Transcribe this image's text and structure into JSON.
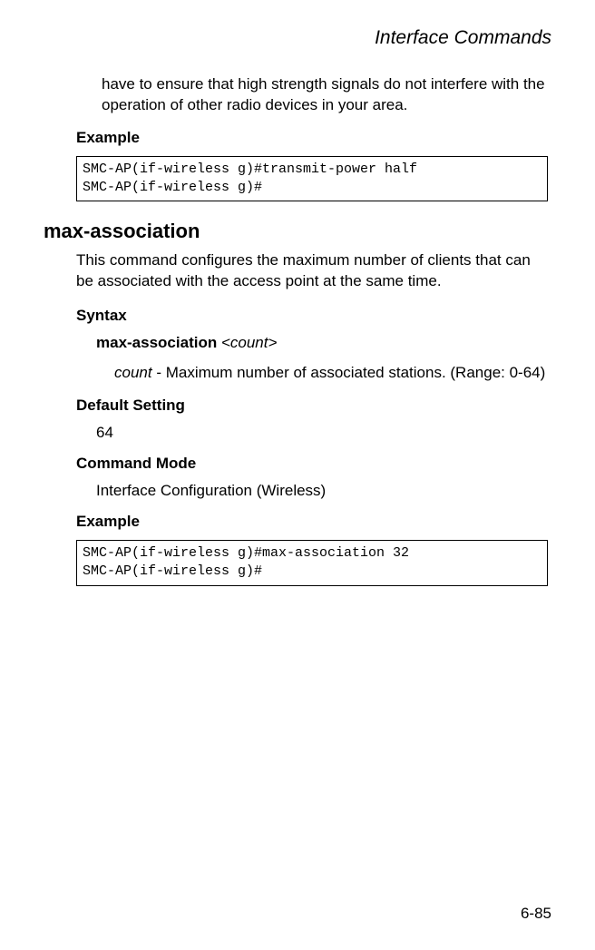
{
  "header": {
    "title": "Interface Commands"
  },
  "continuation": {
    "text": "have to ensure that high strength signals do not interfere with the operation of other radio devices in your area."
  },
  "example1": {
    "label": "Example",
    "code": "SMC-AP(if-wireless g)#transmit-power half\nSMC-AP(if-wireless g)#"
  },
  "command": {
    "name": "max-association",
    "description": "This command configures the maximum number of clients that can be associated with the access point at the same time."
  },
  "syntax": {
    "label": "Syntax",
    "command_bold": "max-association",
    "param_italic": "<count>",
    "param_name": "count",
    "param_desc": " - Maximum number of associated stations. (Range: 0-64)"
  },
  "default_setting": {
    "label": "Default Setting",
    "value": "64"
  },
  "command_mode": {
    "label": "Command Mode",
    "value": "Interface Configuration (Wireless)"
  },
  "example2": {
    "label": "Example",
    "code": "SMC-AP(if-wireless g)#max-association 32\nSMC-AP(if-wireless g)#"
  },
  "page_number": "6-85"
}
